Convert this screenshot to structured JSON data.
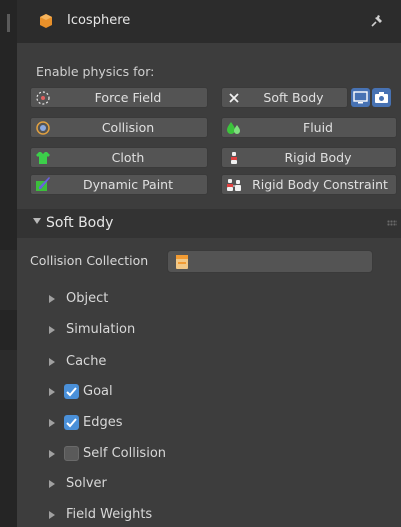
{
  "header": {
    "title": "Icosphere",
    "object_icon": "mesh-object-icon",
    "pin_icon": "pin-icon"
  },
  "physics": {
    "enable_label": "Enable physics for:",
    "buttons": [
      {
        "label": "Force Field",
        "icon": "force-field-icon"
      },
      {
        "label": "Soft Body",
        "icon": "x-remove-icon"
      },
      {
        "label": "Collision",
        "icon": "collision-icon"
      },
      {
        "label": "Fluid",
        "icon": "fluid-icon"
      },
      {
        "label": "Cloth",
        "icon": "cloth-icon"
      },
      {
        "label": "Rigid Body",
        "icon": "rigid-body-icon"
      },
      {
        "label": "Dynamic Paint",
        "icon": "dynamic-paint-icon"
      },
      {
        "label": "Rigid Body Constraint",
        "icon": "rigid-body-constraint-icon"
      }
    ],
    "soft_body_extra_icons": [
      "viewport-display-icon",
      "render-camera-icon"
    ]
  },
  "soft_body": {
    "title": "Soft Body",
    "collision_collection_label": "Collision Collection",
    "subpanels": [
      {
        "label": "Object"
      },
      {
        "label": "Simulation"
      },
      {
        "label": "Cache"
      },
      {
        "label": "Goal",
        "checked": true
      },
      {
        "label": "Edges",
        "checked": true
      },
      {
        "label": "Self Collision",
        "checked": false
      },
      {
        "label": "Solver"
      },
      {
        "label": "Field Weights"
      }
    ]
  },
  "colors": {
    "accent": "#4a90d9",
    "button_bg": "#545454",
    "panel_bg": "#3d3d3d"
  }
}
